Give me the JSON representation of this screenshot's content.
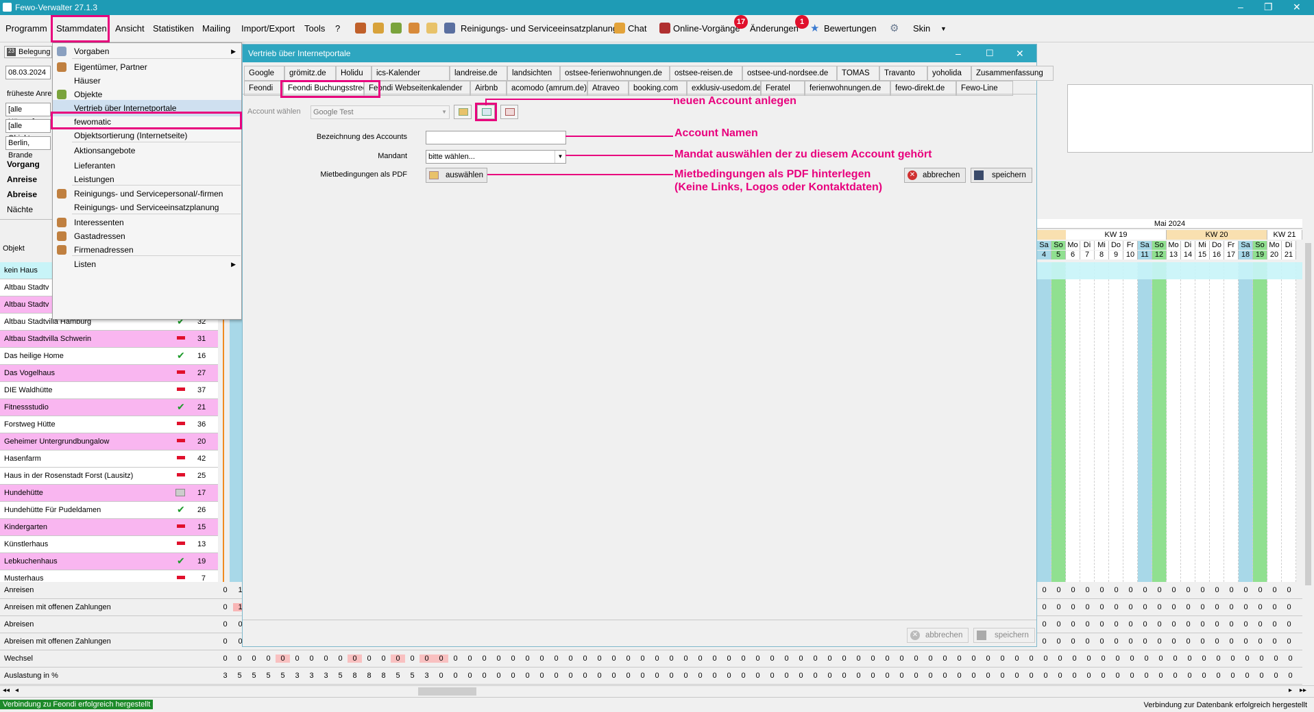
{
  "app": {
    "title": "Fewo-Verwalter 27.1.3"
  },
  "menubar": {
    "items": [
      "Programm",
      "Stammdaten",
      "Ansicht",
      "Statistiken",
      "Mailing",
      "Import/Export",
      "Tools",
      "?"
    ],
    "toolbar": {
      "reinigung": "Reinigungs- und Serviceeinsatzplanung",
      "chat": "Chat",
      "online": "Online-Vorgänge",
      "online_badge": "17",
      "aenderungen": "Änderungen",
      "aenderungen_badge": "1",
      "bewertungen": "Bewertungen",
      "skin": "Skin"
    }
  },
  "left": {
    "belegung": "Belegung",
    "date": "08.03.2024",
    "frueheste": "früheste Anre",
    "haeuser": "[alle Häuser]",
    "objekte": "[alle Objekte",
    "ort": "Berlin, Brande",
    "labels": [
      "Vorgang",
      "Anreise",
      "Abreise",
      "Nächte"
    ],
    "col_objekt": "Objekt",
    "rows": [
      {
        "name": "kein Haus",
        "style": "cyan",
        "mark": "",
        "val": ""
      },
      {
        "name": "Altbau Stadtv",
        "style": "white",
        "mark": "",
        "val": ""
      },
      {
        "name": "Altbau Stadtv",
        "style": "pink",
        "mark": "",
        "val": ""
      },
      {
        "name": "Altbau Stadtvilla Hamburg",
        "style": "white",
        "mark": "check",
        "val": "32"
      },
      {
        "name": "Altbau Stadtvilla Schwerin",
        "style": "pink",
        "mark": "minus",
        "val": "31"
      },
      {
        "name": "Das heilige Home",
        "style": "white",
        "mark": "check",
        "val": "16"
      },
      {
        "name": "Das Vogelhaus",
        "style": "pink",
        "mark": "minus",
        "val": "27"
      },
      {
        "name": "DIE Waldhütte",
        "style": "white",
        "mark": "minus",
        "val": "37"
      },
      {
        "name": "Fitnessstudio",
        "style": "pink",
        "mark": "check",
        "val": "21"
      },
      {
        "name": "Forstweg Hütte",
        "style": "white",
        "mark": "minus",
        "val": "36"
      },
      {
        "name": "Geheimer Untergrundbungalow",
        "style": "pink",
        "mark": "minus",
        "val": "20"
      },
      {
        "name": "Hasenfarm",
        "style": "white",
        "mark": "minus",
        "val": "42"
      },
      {
        "name": "Haus in der Rosenstadt Forst (Lausitz)",
        "style": "white",
        "mark": "minus",
        "val": "25"
      },
      {
        "name": "Hundehütte",
        "style": "pink",
        "mark": "card",
        "val": "17"
      },
      {
        "name": "Hundehütte Für Pudeldamen",
        "style": "white",
        "mark": "check",
        "val": "26"
      },
      {
        "name": "Kindergarten",
        "style": "pink",
        "mark": "minus",
        "val": "15"
      },
      {
        "name": "Künstlerhaus",
        "style": "white",
        "mark": "minus",
        "val": "13"
      },
      {
        "name": "Lebkuchenhaus",
        "style": "pink",
        "mark": "check",
        "val": "19"
      },
      {
        "name": "Musterhaus",
        "style": "white",
        "mark": "minus",
        "val": "7"
      }
    ]
  },
  "dropdown": {
    "items": [
      {
        "label": "Vorgaben",
        "icon": "grid",
        "arrow": true
      },
      {
        "label": "Eigentümer, Partner",
        "icon": "person"
      },
      {
        "label": "Häuser",
        "icon": ""
      },
      {
        "label": "Objekte",
        "icon": "house"
      },
      {
        "label": "Vertrieb über Internetportale",
        "icon": "",
        "selected": true
      },
      {
        "label": "fewomatic",
        "icon": ""
      },
      {
        "label": "Objektsortierung (Internetseite)",
        "icon": ""
      },
      {
        "label": "Aktionsangebote",
        "icon": ""
      },
      {
        "label": "Lieferanten",
        "icon": ""
      },
      {
        "label": "Leistungen",
        "icon": ""
      },
      {
        "label": "Reinigungs- und Servicepersonal/-firmen",
        "icon": "person"
      },
      {
        "label": "Reinigungs- und Serviceeinsatzplanung",
        "icon": ""
      },
      {
        "label": "Interessenten",
        "icon": "person"
      },
      {
        "label": "Gastadressen",
        "icon": "person"
      },
      {
        "label": "Firmenadressen",
        "icon": "person"
      },
      {
        "label": "Listen",
        "icon": "",
        "arrow": true
      }
    ]
  },
  "dialog": {
    "title": "Vertrieb über Internetportale",
    "tabs_row1": [
      "Google",
      "grömitz.de",
      "Holidu",
      "ics-Kalender",
      "landreise.de",
      "landsichten",
      "ostsee-ferienwohnungen.de",
      "ostsee-reisen.de",
      "ostsee-und-nordsee.de",
      "TOMAS",
      "Travanto",
      "yoholida",
      "Zusammenfassung"
    ],
    "tabs_row2": [
      "Feondi",
      "Feondi Buchungsstrecke",
      "Feondi Webseitenkalender",
      "Airbnb",
      "acomodo (amrum.de)",
      "Atraveo",
      "booking.com",
      "exklusiv-usedom.de",
      "Feratel",
      "ferienwohnungen.de",
      "fewo-direkt.de",
      "Fewo-Line"
    ],
    "account_label": "Account wählen",
    "account_value": "Google Test",
    "bez_label": "Bezeichnung des Accounts",
    "bez_value": "",
    "mandant_label": "Mandant",
    "mandant_value": "bitte wählen...",
    "pdf_label": "Mietbedingungen als PDF",
    "pdf_button": "auswählen",
    "abbrechen": "abbrechen",
    "speichern": "speichern",
    "annot": {
      "neu": "neuen Account anlegen",
      "name": "Account Namen",
      "mandant": "Mandat auswählen der zu diesem Account gehört",
      "pdf1": "Mietbedingungen als PDF hinterlegen",
      "pdf2": "(Keine Links, Logos oder Kontaktdaten)"
    }
  },
  "calendar": {
    "month": "Mai 2024",
    "weeks": [
      "KW 19",
      "KW 20",
      "KW 21"
    ],
    "days": [
      {
        "d": "Sa",
        "n": "4",
        "t": "we"
      },
      {
        "d": "So",
        "n": "5",
        "t": "su"
      },
      {
        "d": "Mo",
        "n": "6"
      },
      {
        "d": "Di",
        "n": "7"
      },
      {
        "d": "Mi",
        "n": "8"
      },
      {
        "d": "Do",
        "n": "9"
      },
      {
        "d": "Fr",
        "n": "10"
      },
      {
        "d": "Sa",
        "n": "11",
        "t": "we"
      },
      {
        "d": "So",
        "n": "12",
        "t": "su"
      },
      {
        "d": "Mo",
        "n": "13"
      },
      {
        "d": "Di",
        "n": "14"
      },
      {
        "d": "Mi",
        "n": "15"
      },
      {
        "d": "Do",
        "n": "16"
      },
      {
        "d": "Fr",
        "n": "17"
      },
      {
        "d": "Sa",
        "n": "18",
        "t": "we"
      },
      {
        "d": "So",
        "n": "19",
        "t": "su"
      },
      {
        "d": "Mo",
        "n": "20"
      },
      {
        "d": "Di",
        "n": "21"
      }
    ]
  },
  "bottom": {
    "rows": [
      "Anreisen",
      "Anreisen mit offenen Zahlungen",
      "Abreisen",
      "Abreisen mit offenen Zahlungen",
      "Wechsel",
      "Auslastung in %"
    ],
    "auslastung": [
      "3",
      "5",
      "5",
      "5",
      "5",
      "3",
      "3",
      "3",
      "5",
      "8",
      "8",
      "8",
      "5",
      "5",
      "3",
      "0"
    ]
  },
  "status": {
    "left": "Verbindung zu Feondi erfolgreich hergestellt",
    "right": "Verbindung zur Datenbank erfolgreich hergestellt"
  }
}
